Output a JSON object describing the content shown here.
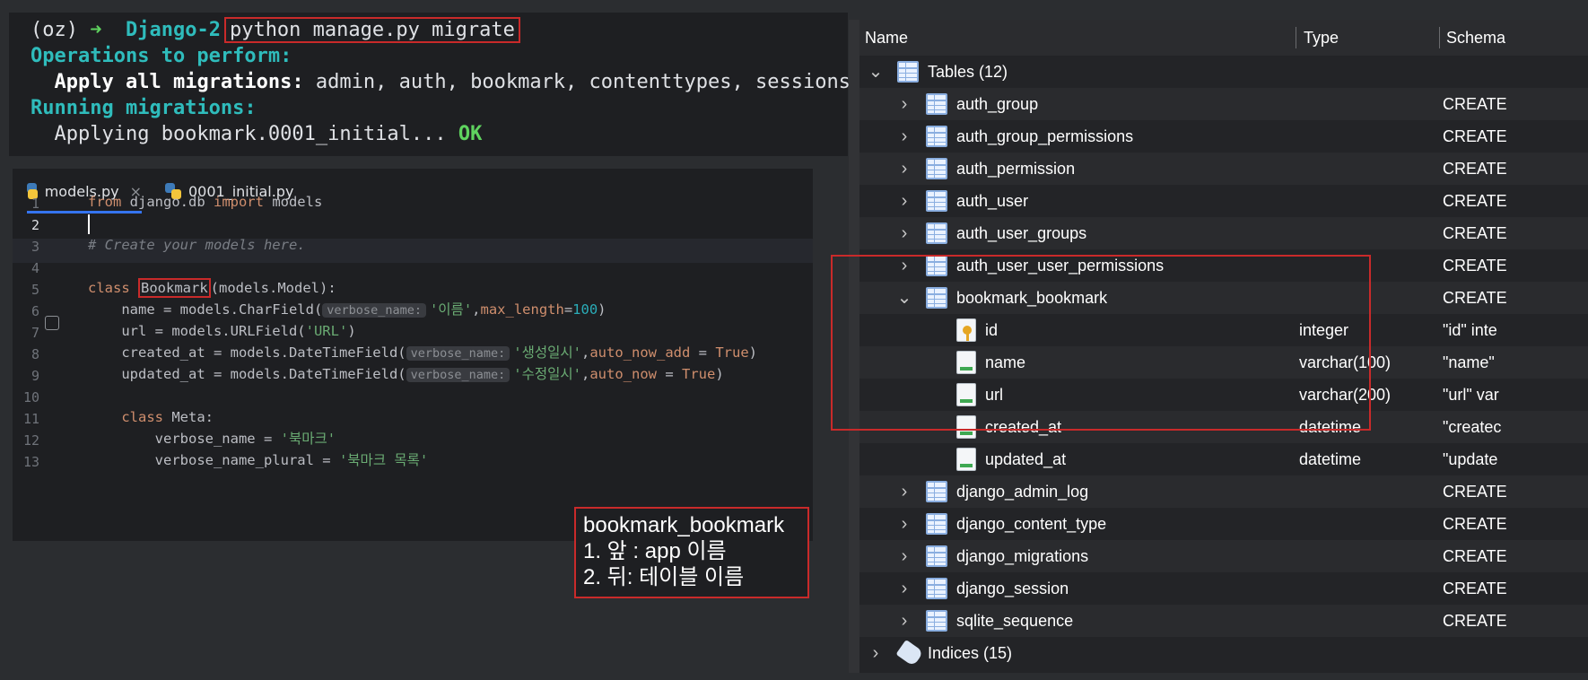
{
  "terminal": {
    "prompt_env": "(oz)",
    "prompt_arrow": "➜",
    "prompt_dir": "Django-2",
    "command": "python manage.py migrate",
    "line2": "Operations to perform:",
    "line3_label": "Apply all migrations:",
    "line3_value": " admin, auth, bookmark, contenttypes, sessions",
    "line4": "Running migrations:",
    "line5_text": "  Applying bookmark.0001_initial... ",
    "line5_ok": "OK"
  },
  "editor": {
    "tabs": [
      {
        "label": "models.py",
        "close": "×"
      },
      {
        "label": "0001_initial.py"
      }
    ],
    "line_numbers": [
      "1",
      "2",
      "3",
      "4",
      "5",
      "6",
      "7",
      "8",
      "9",
      "10",
      "11",
      "12",
      "13"
    ],
    "tokens": {
      "from": "from",
      "mod": " django.db ",
      "import": "import",
      "models": " models",
      "comment": "# Create your models here.",
      "class_kw": "class",
      "class_name": "Bookmark",
      "class_base": "(models.Model):",
      "name_lhs": "    name = models.CharField(",
      "verbose_name_hint": "verbose_name:",
      "name_str": "'이름'",
      "comma": ",",
      "max_length": "max_length",
      "eq": "=",
      "num100": "100",
      "close": ")",
      "url_lhs": "    url = models.URLField(",
      "url_str": "'URL'",
      "created_lhs": "    created_at = models.DateTimeField(",
      "created_str": "'생성일시'",
      "auto_now_add": "auto_now_add",
      "eq_sp": " = ",
      "true": "True",
      "updated_lhs": "    updated_at = models.DateTimeField(",
      "updated_str": "'수정일시'",
      "auto_now": "auto_now",
      "meta_indent": "    ",
      "meta": " Meta:",
      "vn_lhs": "        verbose_name = ",
      "vn_str": "'북마크'",
      "vnp_lhs": "        verbose_name_plural = ",
      "vnp_str": "'북마크 목록'"
    }
  },
  "annotation": {
    "line1": "bookmark_bookmark",
    "line2": "1. 앞 : app 이름",
    "line3": "2. 뒤: 테이블 이름"
  },
  "db": {
    "headers": {
      "name": "Name",
      "type": "Type",
      "schema": "Schema"
    },
    "tables_label": "Tables (12)",
    "indices_label": "Indices (15)",
    "schema_prefix": "CREATE",
    "tables": [
      "auth_group",
      "auth_group_permissions",
      "auth_permission",
      "auth_user",
      "auth_user_groups",
      "auth_user_user_permissions",
      "bookmark_bookmark",
      "django_admin_log",
      "django_content_type",
      "django_migrations",
      "django_session",
      "sqlite_sequence"
    ],
    "bookmark_fields": [
      {
        "name": "id",
        "type": "integer",
        "schema": "\"id\" inte",
        "pk": true
      },
      {
        "name": "name",
        "type": "varchar(100)",
        "schema": "\"name\""
      },
      {
        "name": "url",
        "type": "varchar(200)",
        "schema": "\"url\" var"
      },
      {
        "name": "created_at",
        "type": "datetime",
        "schema": "\"createc"
      },
      {
        "name": "updated_at",
        "type": "datetime",
        "schema": "\"update"
      }
    ]
  },
  "colors": {
    "highlight_red": "#c92a2a",
    "terminal_cyan": "#2fbcbc",
    "ok_green": "#5fd35f",
    "tab_accent": "#3574f0"
  }
}
